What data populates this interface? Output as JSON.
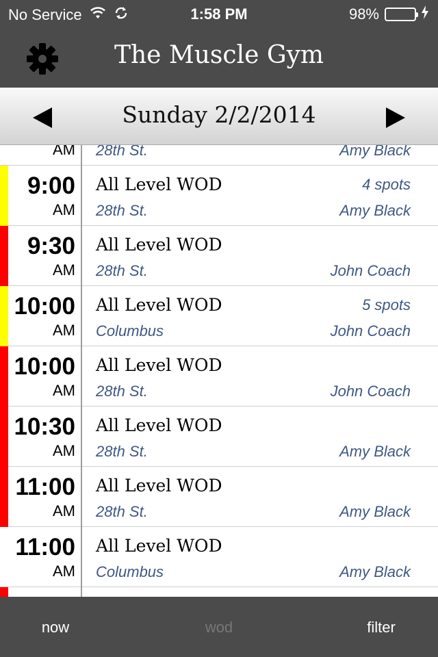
{
  "status_bar": {
    "carrier": "No Service",
    "time": "1:58 PM",
    "battery_text": "98%",
    "battery_level": 0.98,
    "battery_color": "#4cd964"
  },
  "nav": {
    "title": "The Muscle Gym",
    "settings_icon": "gear-icon"
  },
  "date_bar": {
    "date": "Sunday 2/2/2014",
    "prev_icon": "triangle-left-icon",
    "next_icon": "triangle-right-icon"
  },
  "colors": {
    "bar_bg": "#4b4b4b",
    "link_blue": "#3f5885",
    "flag_red": "#ff0000",
    "flag_yellow": "#ffff00"
  },
  "classes": [
    {
      "time": "",
      "ampm": "AM",
      "name": "",
      "spots": "",
      "location": "28th St.",
      "coach": "Amy Black",
      "flag": ""
    },
    {
      "time": "9:00",
      "ampm": "AM",
      "name": "All Level WOD",
      "spots": "4 spots",
      "location": "28th St.",
      "coach": "Amy Black",
      "flag": "yellow"
    },
    {
      "time": "9:30",
      "ampm": "AM",
      "name": "All Level WOD",
      "spots": "",
      "location": "28th St.",
      "coach": "John Coach",
      "flag": "red"
    },
    {
      "time": "10:00",
      "ampm": "AM",
      "name": "All Level WOD",
      "spots": "5 spots",
      "location": "Columbus",
      "coach": "John Coach",
      "flag": "yellow"
    },
    {
      "time": "10:00",
      "ampm": "AM",
      "name": "All Level WOD",
      "spots": "",
      "location": "28th St.",
      "coach": "John Coach",
      "flag": "red"
    },
    {
      "time": "10:30",
      "ampm": "AM",
      "name": "All Level WOD",
      "spots": "",
      "location": "28th St.",
      "coach": "Amy Black",
      "flag": "red"
    },
    {
      "time": "11:00",
      "ampm": "AM",
      "name": "All Level WOD",
      "spots": "",
      "location": "28th St.",
      "coach": "Amy Black",
      "flag": "red"
    },
    {
      "time": "11:00",
      "ampm": "AM",
      "name": "All Level WOD",
      "spots": "",
      "location": "Columbus",
      "coach": "Amy Black",
      "flag": ""
    },
    {
      "time": "",
      "ampm": "",
      "name": "",
      "spots": "",
      "location": "",
      "coach": "",
      "flag": "red"
    }
  ],
  "tabs": {
    "now": "now",
    "wod": "wod",
    "filter": "filter"
  }
}
